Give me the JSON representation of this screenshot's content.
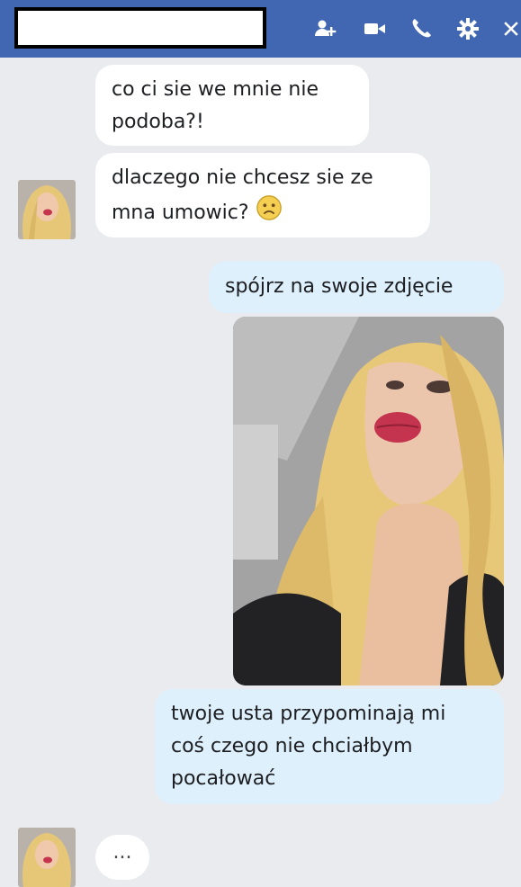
{
  "header": {
    "name": "",
    "icons": [
      "add-people-icon",
      "video-call-icon",
      "phone-icon",
      "gear-icon",
      "close-icon"
    ],
    "color": "#4267b2"
  },
  "messages": [
    {
      "side": "incoming",
      "lines": [
        "co ci sie we mnie nie",
        "podoba?!"
      ]
    },
    {
      "side": "incoming",
      "lines": [
        "dlaczego nie chcesz sie ze",
        "mna umowic?"
      ],
      "emoji": "frown-emoji"
    },
    {
      "side": "outgoing",
      "lines": [
        "spójrz na swoje zdjęcie"
      ]
    },
    {
      "side": "outgoing",
      "type": "photo",
      "icon": "selfie-photo"
    },
    {
      "side": "outgoing",
      "lines": [
        "twoje usta przypominają mi",
        "coś czego nie chciałbym",
        "pocałować"
      ]
    },
    {
      "side": "incoming",
      "typing": "..."
    }
  ],
  "colors": {
    "incoming_bg": "#ffffff",
    "outgoing_bg": "#dff0fd",
    "chat_bg": "#e9ebee"
  }
}
